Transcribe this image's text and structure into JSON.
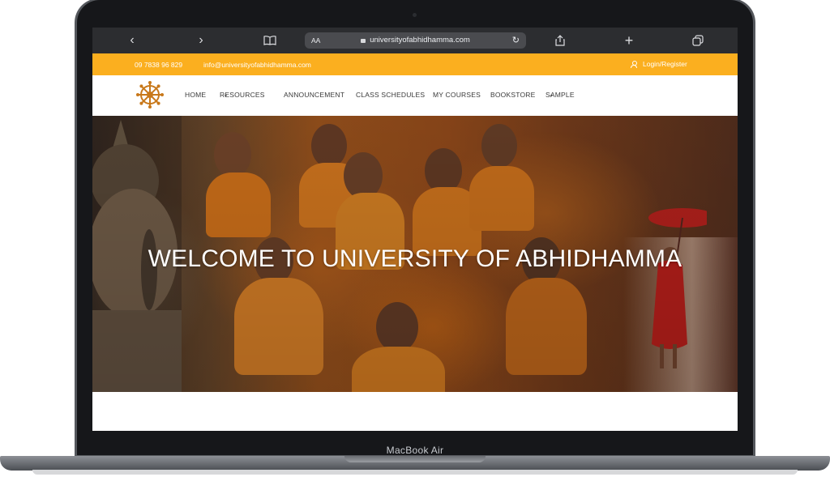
{
  "browser": {
    "url": "universityofabhidhamma.com",
    "text_size_label": "AA",
    "icons": [
      "back-icon",
      "forward-icon",
      "bookmarks-icon",
      "reload-icon",
      "share-icon",
      "new-tab-icon",
      "tabs-icon"
    ]
  },
  "topbar": {
    "phone": "09 7838 96 829",
    "email": "info@universityofabhidhamma.com",
    "login": "Login/Register",
    "color": "#fbaf1f"
  },
  "nav": {
    "items": [
      {
        "label": "HOME"
      },
      {
        "label": "RESOURCES",
        "dropdown": true
      },
      {
        "label": "ANNOUNCEMENT"
      },
      {
        "label": "CLASS SCHEDULES"
      },
      {
        "label": "MY COURSES"
      },
      {
        "label": "BOOKSTORE"
      },
      {
        "label": "SAMPLE",
        "dropdown": true
      }
    ],
    "logo_icon": "dharma-wheel-icon"
  },
  "hero": {
    "title": "WELCOME TO UNIVERSITY OF ABHIDHAMMA"
  },
  "device": {
    "label": "MacBook Air"
  }
}
